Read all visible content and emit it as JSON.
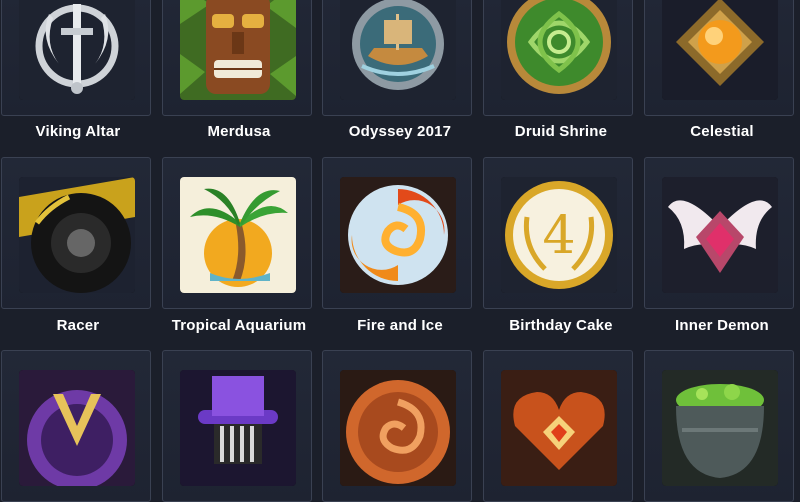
{
  "achievements": [
    {
      "name": "Viking Altar",
      "icon": "viking-sword-dragons-icon"
    },
    {
      "name": "Merdusa",
      "icon": "tiki-mask-icon"
    },
    {
      "name": "Odyssey 2017",
      "icon": "viking-ship-medallion-icon"
    },
    {
      "name": "Druid Shrine",
      "icon": "celtic-knot-icon"
    },
    {
      "name": "Celestial",
      "icon": "golden-orb-icon"
    },
    {
      "name": "Racer",
      "icon": "racing-tire-icon"
    },
    {
      "name": "Tropical Aquarium",
      "icon": "palm-tree-sun-icon"
    },
    {
      "name": "Fire and Ice",
      "icon": "fire-ice-swirl-icon"
    },
    {
      "name": "Birthday Cake",
      "icon": "number-four-laurel-icon"
    },
    {
      "name": "Inner Demon",
      "icon": "winged-gem-icon"
    },
    {
      "name": "",
      "icon": "purple-v-emblem-icon"
    },
    {
      "name": "",
      "icon": "top-hat-icon"
    },
    {
      "name": "",
      "icon": "spiral-medallion-icon"
    },
    {
      "name": "",
      "icon": "heart-gem-icon"
    },
    {
      "name": "",
      "icon": "cauldron-icon"
    }
  ],
  "colors": {
    "background": "#1b1f2a",
    "tile_border": "#3a4152",
    "label": "#ffffff"
  }
}
